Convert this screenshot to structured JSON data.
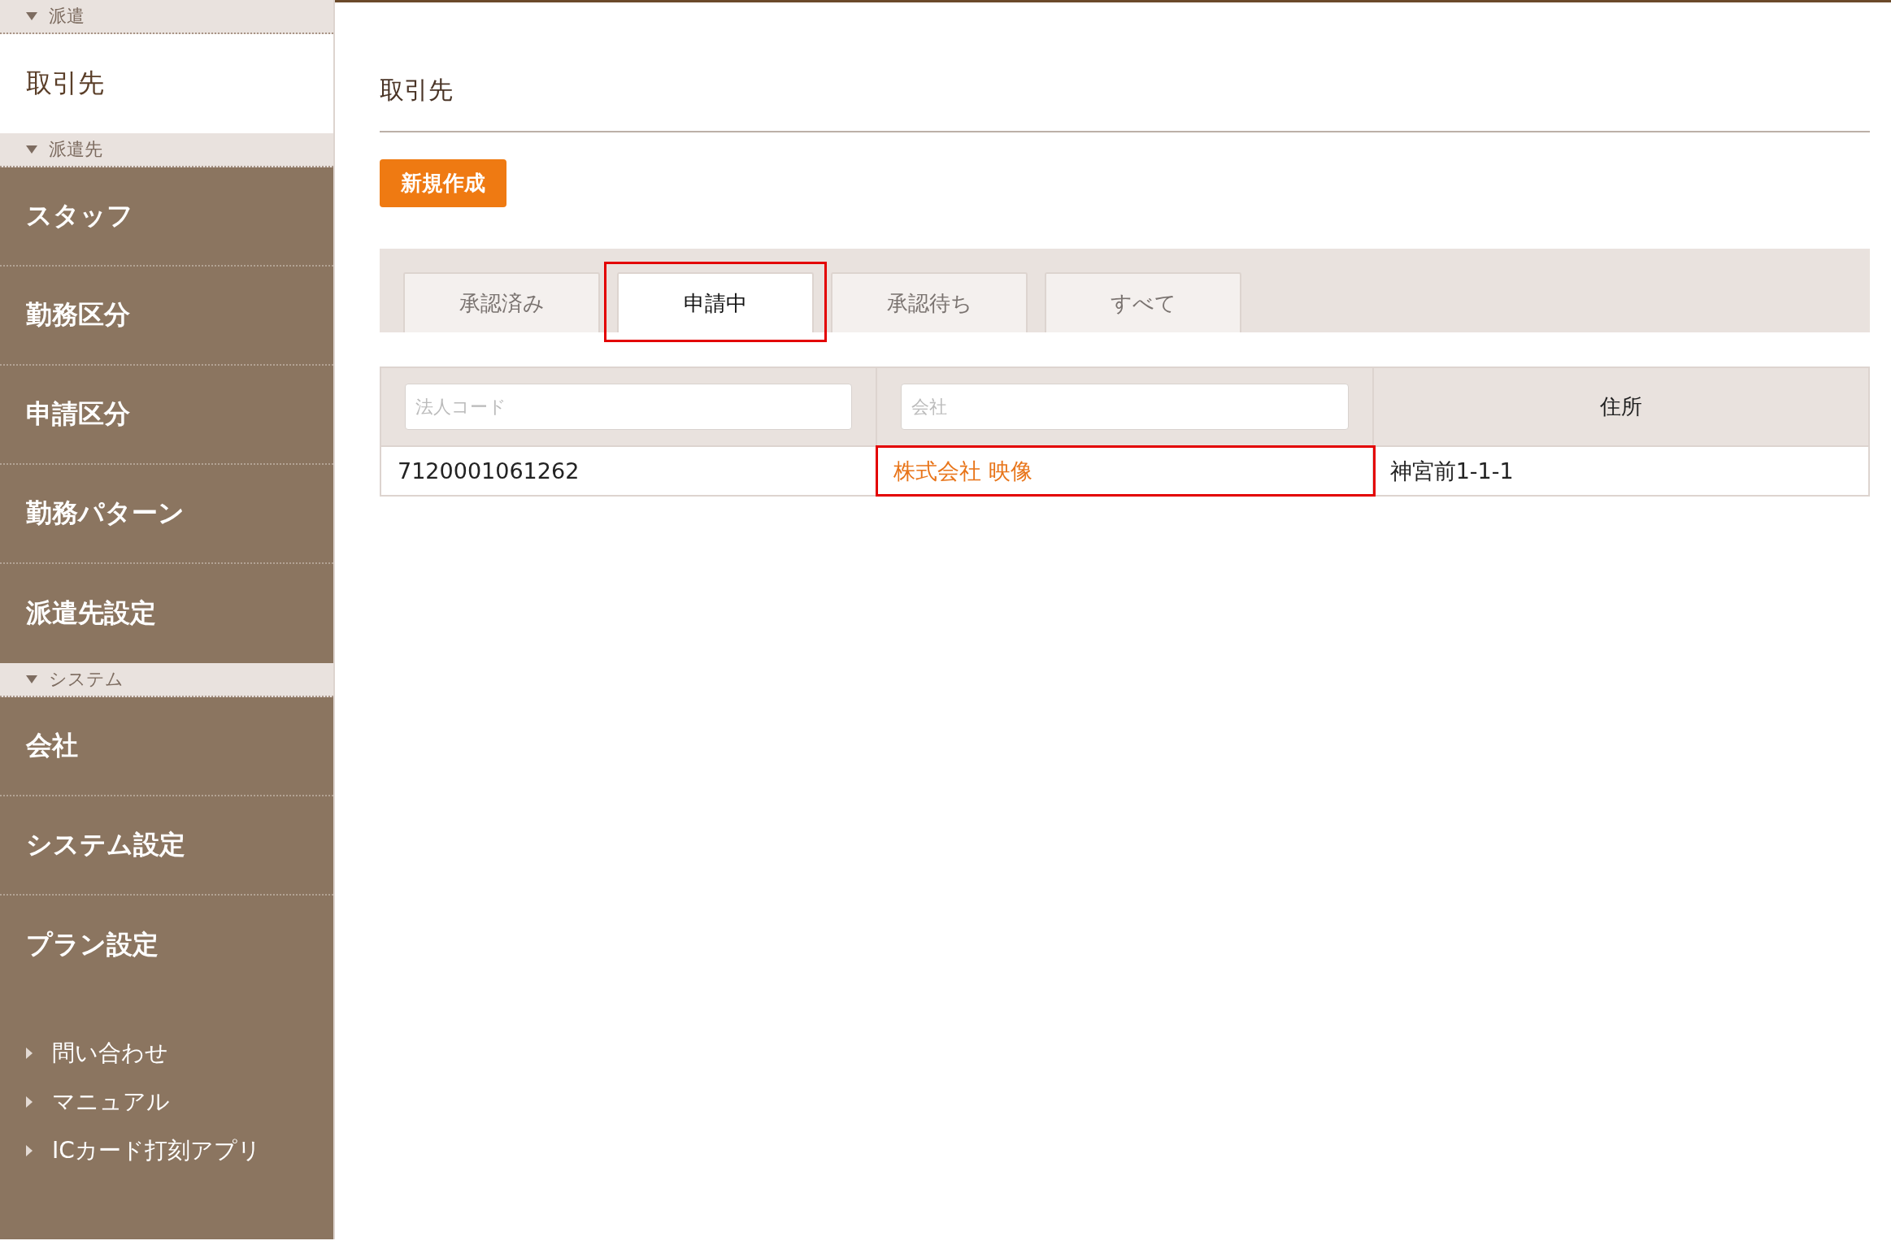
{
  "sidebar": {
    "sections": [
      {
        "title": "派遣",
        "expanded": true,
        "items": [
          {
            "label": "取引先",
            "selected": true
          }
        ]
      },
      {
        "title": "派遣先",
        "expanded": true,
        "items": [
          {
            "label": "スタッフ",
            "selected": false
          },
          {
            "label": "勤務区分",
            "selected": false
          },
          {
            "label": "申請区分",
            "selected": false
          },
          {
            "label": "勤務パターン",
            "selected": false
          },
          {
            "label": "派遣先設定",
            "selected": false
          }
        ]
      },
      {
        "title": "システム",
        "expanded": true,
        "items": [
          {
            "label": "会社",
            "selected": false
          },
          {
            "label": "システム設定",
            "selected": false
          },
          {
            "label": "プラン設定",
            "selected": false
          }
        ]
      }
    ],
    "links": [
      "問い合わせ",
      "マニュアル",
      "ICカード打刻アプリ"
    ]
  },
  "page": {
    "title": "取引先"
  },
  "new_button": "新規作成",
  "tabs": [
    {
      "label": "承認済み",
      "selected": false,
      "highlighted": false
    },
    {
      "label": "申請中",
      "selected": true,
      "highlighted": true
    },
    {
      "label": "承認待ち",
      "selected": false,
      "highlighted": false
    },
    {
      "label": "すべて",
      "selected": false,
      "highlighted": false
    }
  ],
  "table": {
    "columns": [
      {
        "kind": "filter",
        "placeholder": "法人コード"
      },
      {
        "kind": "filter",
        "placeholder": "会社"
      },
      {
        "kind": "header",
        "label": "住所"
      }
    ],
    "rows": [
      {
        "cells": [
          {
            "kind": "text",
            "text": "7120001061262",
            "highlighted": false
          },
          {
            "kind": "link",
            "text": "株式会社 映像",
            "highlighted": true
          },
          {
            "kind": "text",
            "text": "神宮前1-1-1",
            "highlighted": false
          }
        ]
      }
    ]
  }
}
